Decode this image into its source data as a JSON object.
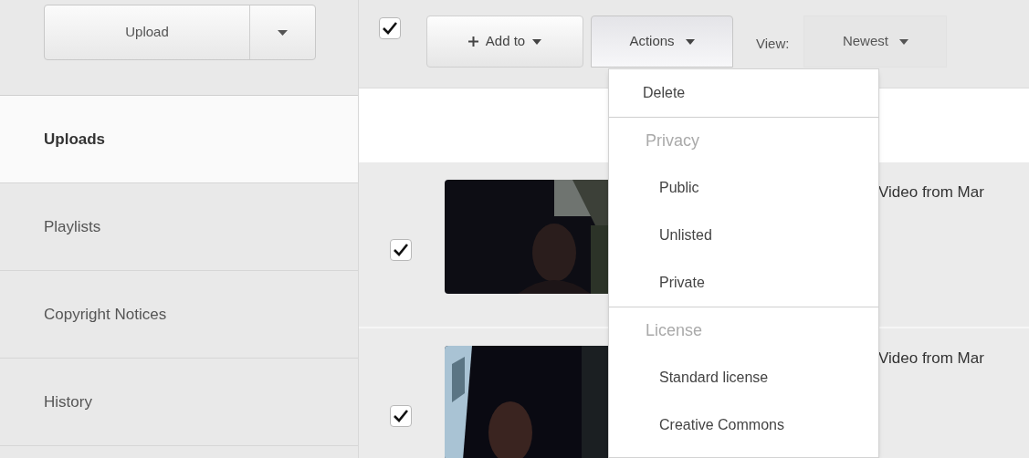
{
  "sidebar": {
    "upload_button": {
      "label": "Upload"
    },
    "items": [
      {
        "label": "Uploads",
        "selected": true
      },
      {
        "label": "Playlists",
        "selected": false
      },
      {
        "label": "Copyright Notices",
        "selected": false
      },
      {
        "label": "History",
        "selected": false
      }
    ]
  },
  "toolbar": {
    "select_all": {
      "checked": true
    },
    "add_to": {
      "label": "Add to"
    },
    "actions": {
      "label": "Actions",
      "expanded": true
    },
    "view_label": "View:",
    "view": {
      "label": "Newest"
    }
  },
  "actions_menu": [
    {
      "kind": "item",
      "label": "Delete"
    },
    {
      "kind": "header",
      "label": "Privacy"
    },
    {
      "kind": "item",
      "label": "Public"
    },
    {
      "kind": "item",
      "label": "Unlisted"
    },
    {
      "kind": "item",
      "label": "Private"
    },
    {
      "kind": "header",
      "label": "License"
    },
    {
      "kind": "item",
      "label": "Standard license"
    },
    {
      "kind": "item",
      "label": "Creative Commons"
    }
  ],
  "videos": [
    {
      "checked": true,
      "title": "Video from Mar"
    },
    {
      "checked": true,
      "title": "Video from Mar"
    }
  ]
}
